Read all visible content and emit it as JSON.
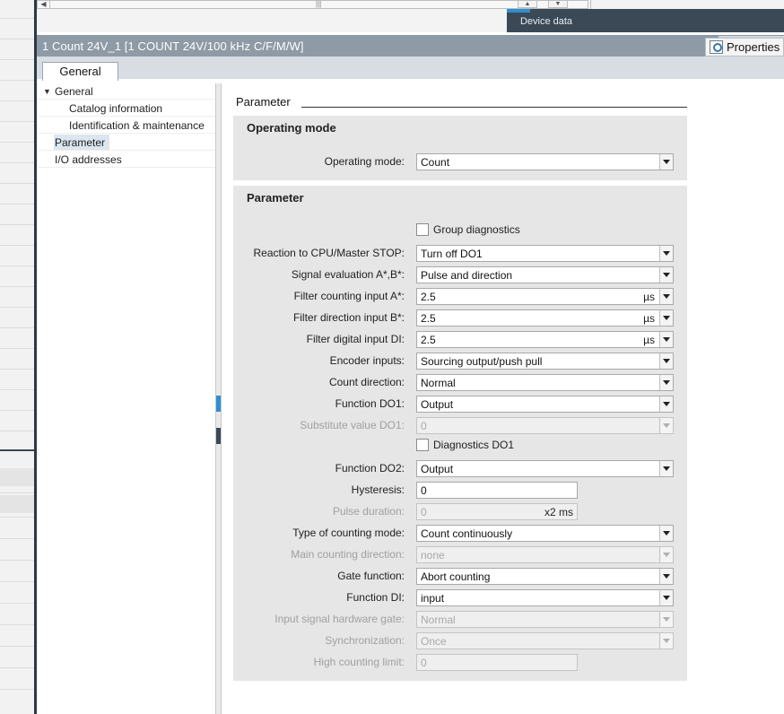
{
  "top": {
    "device_data_tab": "Device data"
  },
  "header": {
    "title": "1 Count 24V_1 [1 COUNT 24V/100 kHz C/F/M/W]",
    "properties_label": "Properties"
  },
  "tabs": {
    "general": "General"
  },
  "nav": {
    "items": [
      {
        "label": "General",
        "expanded": true
      },
      {
        "label": "Catalog information"
      },
      {
        "label": "Identification & maintenance"
      },
      {
        "label": "Parameter",
        "selected": true
      },
      {
        "label": "I/O addresses"
      }
    ]
  },
  "content": {
    "section_title": "Parameter",
    "operating_mode_group": {
      "title": "Operating mode",
      "operating_mode_label": "Operating mode:",
      "operating_mode_value": "Count"
    },
    "parameter_group": {
      "title": "Parameter",
      "group_diagnostics_label": "Group diagnostics",
      "group_diagnostics_checked": false,
      "reaction_label": "Reaction to CPU/Master STOP:",
      "reaction_value": "Turn off DO1",
      "signal_eval_label": "Signal evaluation A*,B*:",
      "signal_eval_value": "Pulse and direction",
      "filter_a_label": "Filter counting input A*:",
      "filter_a_value": "2.5",
      "filter_a_unit": "µs",
      "filter_b_label": "Filter direction input B*:",
      "filter_b_value": "2.5",
      "filter_b_unit": "µs",
      "filter_di_label": "Filter digital input DI:",
      "filter_di_value": "2.5",
      "filter_di_unit": "µs",
      "encoder_label": "Encoder inputs:",
      "encoder_value": "Sourcing output/push pull",
      "count_dir_label": "Count direction:",
      "count_dir_value": "Normal",
      "function_do1_label": "Function DO1:",
      "function_do1_value": "Output",
      "subst_do1_label": "Substitute value DO1:",
      "subst_do1_value": "0",
      "diag_do1_label": "Diagnostics DO1",
      "diag_do1_checked": false,
      "function_do2_label": "Function DO2:",
      "function_do2_value": "Output",
      "hysteresis_label": "Hysteresis:",
      "hysteresis_value": "0",
      "pulse_duration_label": "Pulse duration:",
      "pulse_duration_value": "0",
      "pulse_duration_unit": "x2 ms",
      "counting_mode_label": "Type of counting mode:",
      "counting_mode_value": "Count continuously",
      "main_dir_label": "Main counting direction:",
      "main_dir_value": "none",
      "gate_label": "Gate function:",
      "gate_value": "Abort counting",
      "function_di_label": "Function DI:",
      "function_di_value": "input",
      "hw_gate_label": "Input signal hardware gate:",
      "hw_gate_value": "Normal",
      "sync_label": "Synchronization:",
      "sync_value": "Once",
      "high_limit_label": "High counting limit:",
      "high_limit_value": "0"
    }
  },
  "colors": {
    "header_bar": "#8e9aa5",
    "dark_bar": "#3b4957",
    "accent": "#2f8fce",
    "group_bg": "#e6e6e6"
  }
}
